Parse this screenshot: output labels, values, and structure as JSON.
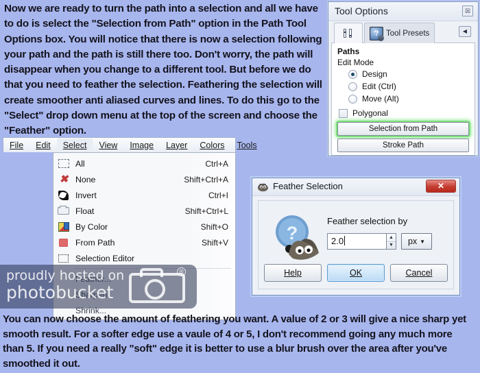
{
  "intro_text": "Now we are ready to turn the path into a selection and all we have to do is select the \"Selection from Path\" option in the Path Tool Options box. You will notice that there is now a selection following your path and the path is still there too. Don't worry, the path will disappear when you change to a different tool. But before we do that you need to feather the selection. Feathering the selection will create smoother anti aliased curves and lines. To do this go to the \"Select\" drop down menu at the top of the screen and choose the \"Feather\" option.",
  "outro_text": "You can now choose the amount of feathering you want. A value of 2 or 3 will give a nice sharp yet smooth result. For a softer edge use a vaule of 4 or 5, I don't recommend going any much more than 5. If you need a really \"soft\" edge it is better to use a blur brush over the area after you've smoothed it out.",
  "tool_options": {
    "title": "Tool Options",
    "close_label": "☒",
    "tabs": [
      {
        "label": "",
        "icon": "sliders-icon"
      },
      {
        "label": "Tool Presets",
        "icon": "tool-presets-icon"
      }
    ],
    "collapse_arrow": "◀",
    "section_heading": "Paths",
    "edit_mode_label": "Edit Mode",
    "radios": [
      {
        "label": "Design",
        "selected": true
      },
      {
        "label": "Edit (Ctrl)",
        "selected": false
      },
      {
        "label": "Move (Alt)",
        "selected": false
      }
    ],
    "checkbox": {
      "label": "Polygonal",
      "checked": false
    },
    "buttons": [
      {
        "label": "Selection from Path",
        "highlighted": true
      },
      {
        "label": "Stroke Path",
        "highlighted": false
      }
    ],
    "highlight_color": "#7ee07e"
  },
  "menubar": {
    "items": [
      "File",
      "Edit",
      "Select",
      "View",
      "Image",
      "Layer",
      "Colors",
      "Tools"
    ],
    "open_item": "Select"
  },
  "select_menu": {
    "items": [
      {
        "label": "All",
        "shortcut": "Ctrl+A",
        "icon": "select-all-icon"
      },
      {
        "label": "None",
        "shortcut": "Shift+Ctrl+A",
        "icon": "select-none-icon"
      },
      {
        "label": "Invert",
        "shortcut": "Ctrl+I",
        "icon": "select-invert-icon"
      },
      {
        "label": "Float",
        "shortcut": "Shift+Ctrl+L",
        "icon": "select-float-icon"
      },
      {
        "label": "By Color",
        "shortcut": "Shift+O",
        "icon": "select-by-color-icon"
      },
      {
        "label": "From Path",
        "shortcut": "Shift+V",
        "icon": "select-from-path-icon"
      },
      {
        "label": "Selection Editor",
        "shortcut": "",
        "icon": "selection-editor-icon"
      },
      {
        "label": "Feather...",
        "shortcut": "",
        "icon": ""
      },
      {
        "label": "Sharpen",
        "shortcut": "",
        "icon": ""
      },
      {
        "label": "Shrink...",
        "shortcut": "",
        "icon": ""
      }
    ]
  },
  "watermark": {
    "line1": "proudly hosted on",
    "line2": "photobucket",
    "registered_mark": "®"
  },
  "feather_dialog": {
    "title": "Feather Selection",
    "close_label": "✕",
    "prompt": "Feather selection by",
    "value": "2.0",
    "unit": "px",
    "unit_caret": "▼",
    "spin_up": "▲",
    "spin_down": "▼",
    "buttons": [
      {
        "label": "Help",
        "default": false
      },
      {
        "label": "OK",
        "default": true
      },
      {
        "label": "Cancel",
        "default": false
      }
    ]
  }
}
